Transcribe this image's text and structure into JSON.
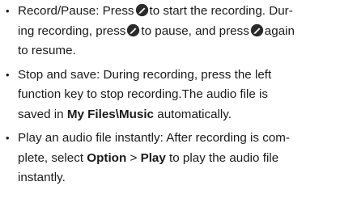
{
  "items": [
    {
      "record": {
        "a": "Record/Pause: Press",
        "b": "to start the recording. Dur-",
        "c": "ing recording, press",
        "d": "to pause, and press",
        "e": "again",
        "f": "to resume."
      },
      "icon": "record-key-icon"
    },
    {
      "stop": {
        "a": "Stop and save: During recording, press the left",
        "b": "function key to stop recording.The audio file is",
        "c": "saved in",
        "d": "My Files\\Music",
        "e": "automatically."
      }
    },
    {
      "play": {
        "a": "Play an audio file instantly: After recording is com-",
        "b": "plete, select",
        "c": "Option",
        "d": ">",
        "e": "Play",
        "f": "to play the audio file",
        "g": "instantly."
      }
    }
  ],
  "bullet": "•"
}
